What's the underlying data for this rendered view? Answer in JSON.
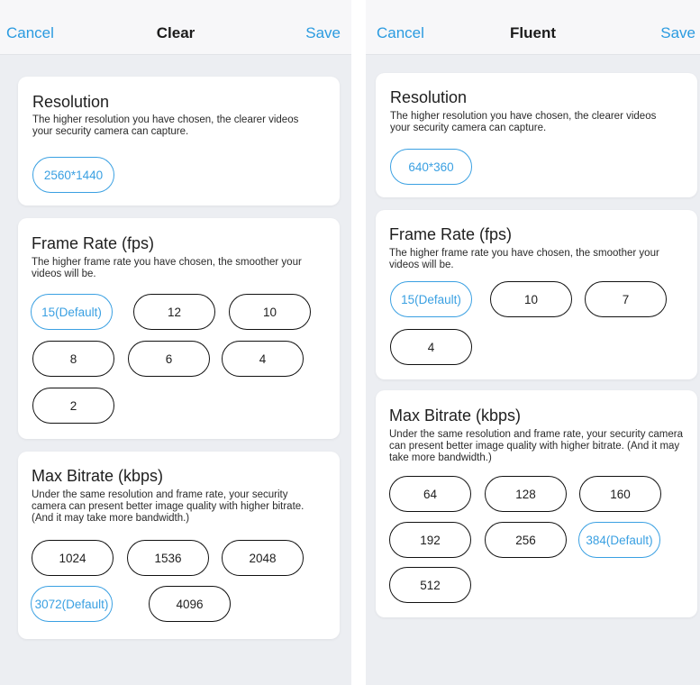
{
  "colors": {
    "accent": "#2b9be0",
    "page_background": "#eceef2",
    "card_background": "#ffffff",
    "unselected_border": "#111111"
  },
  "left_screen": {
    "nav": {
      "cancel_label": "Cancel",
      "title": "Clear",
      "save_label": "Save"
    },
    "resolution": {
      "title": "Resolution",
      "description": "The higher resolution you have chosen, the clearer videos your security camera can capture.",
      "options": [
        "2560*1440"
      ],
      "selected": "2560*1440"
    },
    "frame_rate": {
      "title": "Frame Rate (fps)",
      "description": "The higher frame rate you have chosen, the smoother your videos will be.",
      "options": [
        "15(Default)",
        "12",
        "10",
        "8",
        "6",
        "4",
        "2"
      ],
      "selected": "15(Default)"
    },
    "bitrate": {
      "title": "Max Bitrate (kbps)",
      "description": "Under the same resolution and frame rate, your security camera can present better image quality with higher bitrate. (And it may take more bandwidth.)",
      "options": [
        "1024",
        "1536",
        "2048",
        "3072(Default)",
        "4096"
      ],
      "selected": "3072(Default)"
    }
  },
  "right_screen": {
    "nav": {
      "cancel_label": "Cancel",
      "title": "Fluent",
      "save_label": "Save"
    },
    "resolution": {
      "title": "Resolution",
      "description": "The higher resolution you have chosen, the clearer videos your security camera can capture.",
      "options": [
        "640*360"
      ],
      "selected": "640*360"
    },
    "frame_rate": {
      "title": "Frame Rate (fps)",
      "description": "The higher frame rate you have chosen, the smoother your videos will be.",
      "options": [
        "15(Default)",
        "10",
        "7",
        "4"
      ],
      "selected": "15(Default)"
    },
    "bitrate": {
      "title": "Max Bitrate (kbps)",
      "description": "Under the same resolution and frame rate, your security camera can present better image quality with higher bitrate. (And it may take more bandwidth.)",
      "options": [
        "64",
        "128",
        "160",
        "192",
        "256",
        "384(Default)",
        "512"
      ],
      "selected": "384(Default)"
    }
  }
}
